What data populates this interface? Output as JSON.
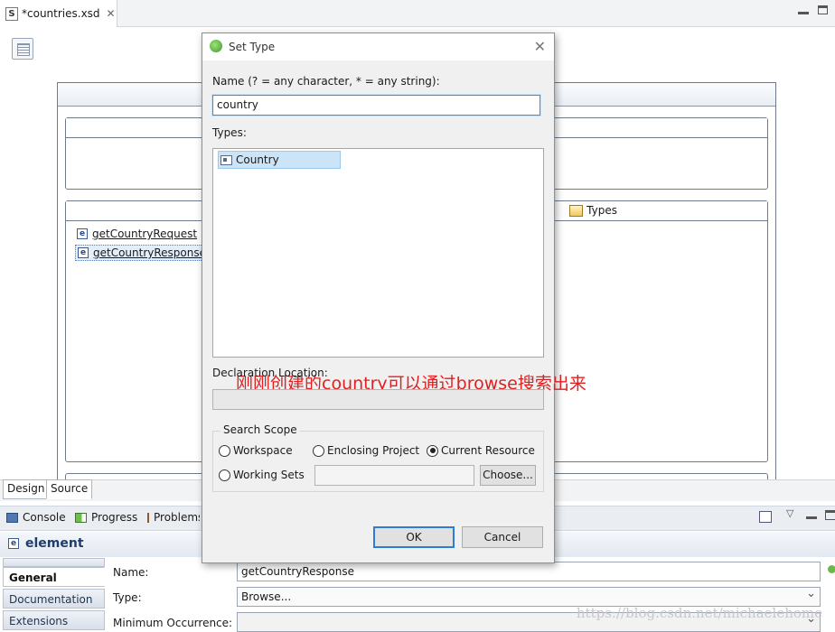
{
  "editor": {
    "tab_label": "*countries.xsd",
    "types_section_title": "Types",
    "elements": [
      {
        "name": "getCountryRequest",
        "suffix": " :"
      },
      {
        "name": "getCountryResponse",
        "suffix": ""
      }
    ],
    "design_tab": "Design",
    "source_tab": "Source"
  },
  "views": {
    "tabs": [
      {
        "label": "Console",
        "icon": "console-icon"
      },
      {
        "label": "Progress",
        "icon": "progress-icon"
      },
      {
        "label": "Problems",
        "icon": "problems-icon"
      }
    ]
  },
  "properties": {
    "title": "element",
    "side_tabs": [
      "General",
      "Documentation",
      "Extensions"
    ],
    "active_tab": "General",
    "fields": {
      "name_label": "Name:",
      "name_value": "getCountryResponse",
      "type_label": "Type:",
      "type_value": "Browse...",
      "min_label": "Minimum Occurrence:",
      "min_value": ""
    }
  },
  "dialog": {
    "title": "Set Type",
    "name_label": "Name (? = any character, * = any string):",
    "name_value": "country",
    "types_label": "Types:",
    "types": [
      {
        "label": "Country",
        "selected": true
      }
    ],
    "annotation": "刚刚创建的country可以通过browse搜索出来",
    "declaration_label": "Declaration Location:",
    "declaration_value": "",
    "scope": {
      "legend": "Search Scope",
      "options": [
        "Workspace",
        "Enclosing Project",
        "Current Resource",
        "Working Sets"
      ],
      "selected": "Current Resource",
      "working_sets_value": "",
      "choose_label": "Choose..."
    },
    "ok_label": "OK",
    "cancel_label": "Cancel"
  },
  "watermark": "https://blog.csdn.net/michaelehome",
  "colors": {
    "annotation": "#e02020",
    "selection": "#cce4f7",
    "focus_border": "#3c8fd6",
    "ok_border": "#2f7bd6"
  }
}
